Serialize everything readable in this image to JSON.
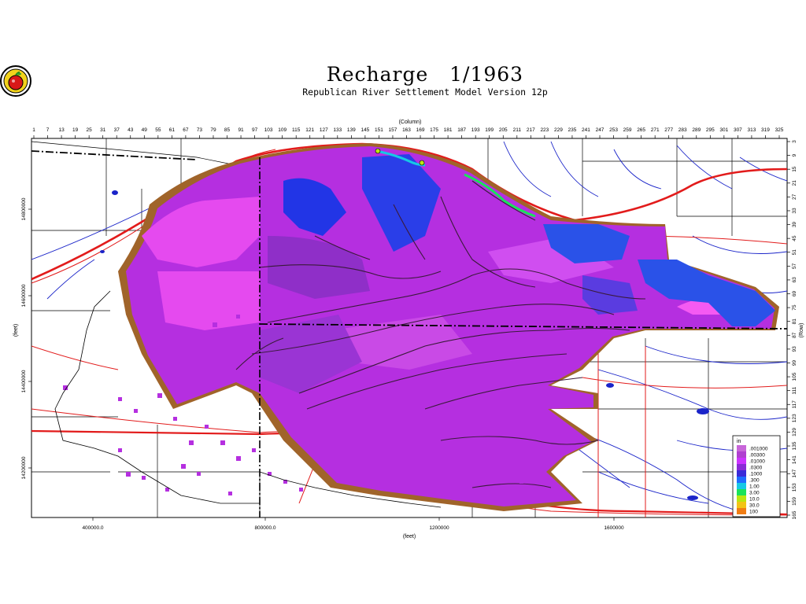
{
  "title": "Recharge   1/1963",
  "subtitle": "Republican River Settlement Model Version 12p",
  "top_axis": {
    "label": "(Column)",
    "ticks": [
      "1",
      "7",
      "13",
      "19",
      "25",
      "31",
      "37",
      "43",
      "49",
      "55",
      "61",
      "67",
      "73",
      "79",
      "85",
      "91",
      "97",
      "103",
      "109",
      "115",
      "121",
      "127",
      "133",
      "139",
      "145",
      "151",
      "157",
      "163",
      "169",
      "175",
      "181",
      "187",
      "193",
      "199",
      "205",
      "211",
      "217",
      "223",
      "229",
      "235",
      "241",
      "247",
      "253",
      "259",
      "265",
      "271",
      "277",
      "283",
      "289",
      "295",
      "301",
      "307",
      "313",
      "319",
      "325"
    ]
  },
  "right_axis": {
    "label": "(Row)",
    "ticks": [
      "3",
      "9",
      "15",
      "21",
      "27",
      "33",
      "39",
      "45",
      "51",
      "57",
      "63",
      "69",
      "75",
      "81",
      "87",
      "93",
      "99",
      "105",
      "111",
      "117",
      "123",
      "129",
      "135",
      "141",
      "147",
      "153",
      "159",
      "165"
    ]
  },
  "left_axis": {
    "label": "(feet)",
    "ticks": [
      "14800000",
      "14600000",
      "14400000",
      "14200000"
    ]
  },
  "bottom_axis": {
    "label": "(feet)",
    "ticks": [
      "400000.0",
      "800000.0",
      "1200000",
      "1600000"
    ]
  },
  "legend": {
    "unit": "in",
    "entries": [
      {
        "label": ".001000",
        "color": "#c866d9"
      },
      {
        "label": ".00300",
        "color": "#b03fd0"
      },
      {
        "label": ".01000",
        "color": "#cc33ff"
      },
      {
        "label": ".0300",
        "color": "#8a2bd6"
      },
      {
        "label": ".1000",
        "color": "#3a2ad8"
      },
      {
        "label": ".300",
        "color": "#1e6cff"
      },
      {
        "label": "1.00",
        "color": "#16c8e6"
      },
      {
        "label": "3.00",
        "color": "#19e35a"
      },
      {
        "label": "10.0",
        "color": "#b9e611"
      },
      {
        "label": "30.0",
        "color": "#f2c416"
      },
      {
        "label": "100",
        "color": "#f07d14"
      }
    ]
  },
  "colors": {
    "recharge_main": "#b52fe0",
    "recharge_light": "#e54aef",
    "recharge_dark": "#8f2fc8",
    "recharge_blue": "#2235e6",
    "rivers": "#1a24c9",
    "roads": "#e21b1b",
    "county_lines": "#000000",
    "edge_brown": "#a0642a"
  },
  "logo_icon": "apple-seal-icon"
}
